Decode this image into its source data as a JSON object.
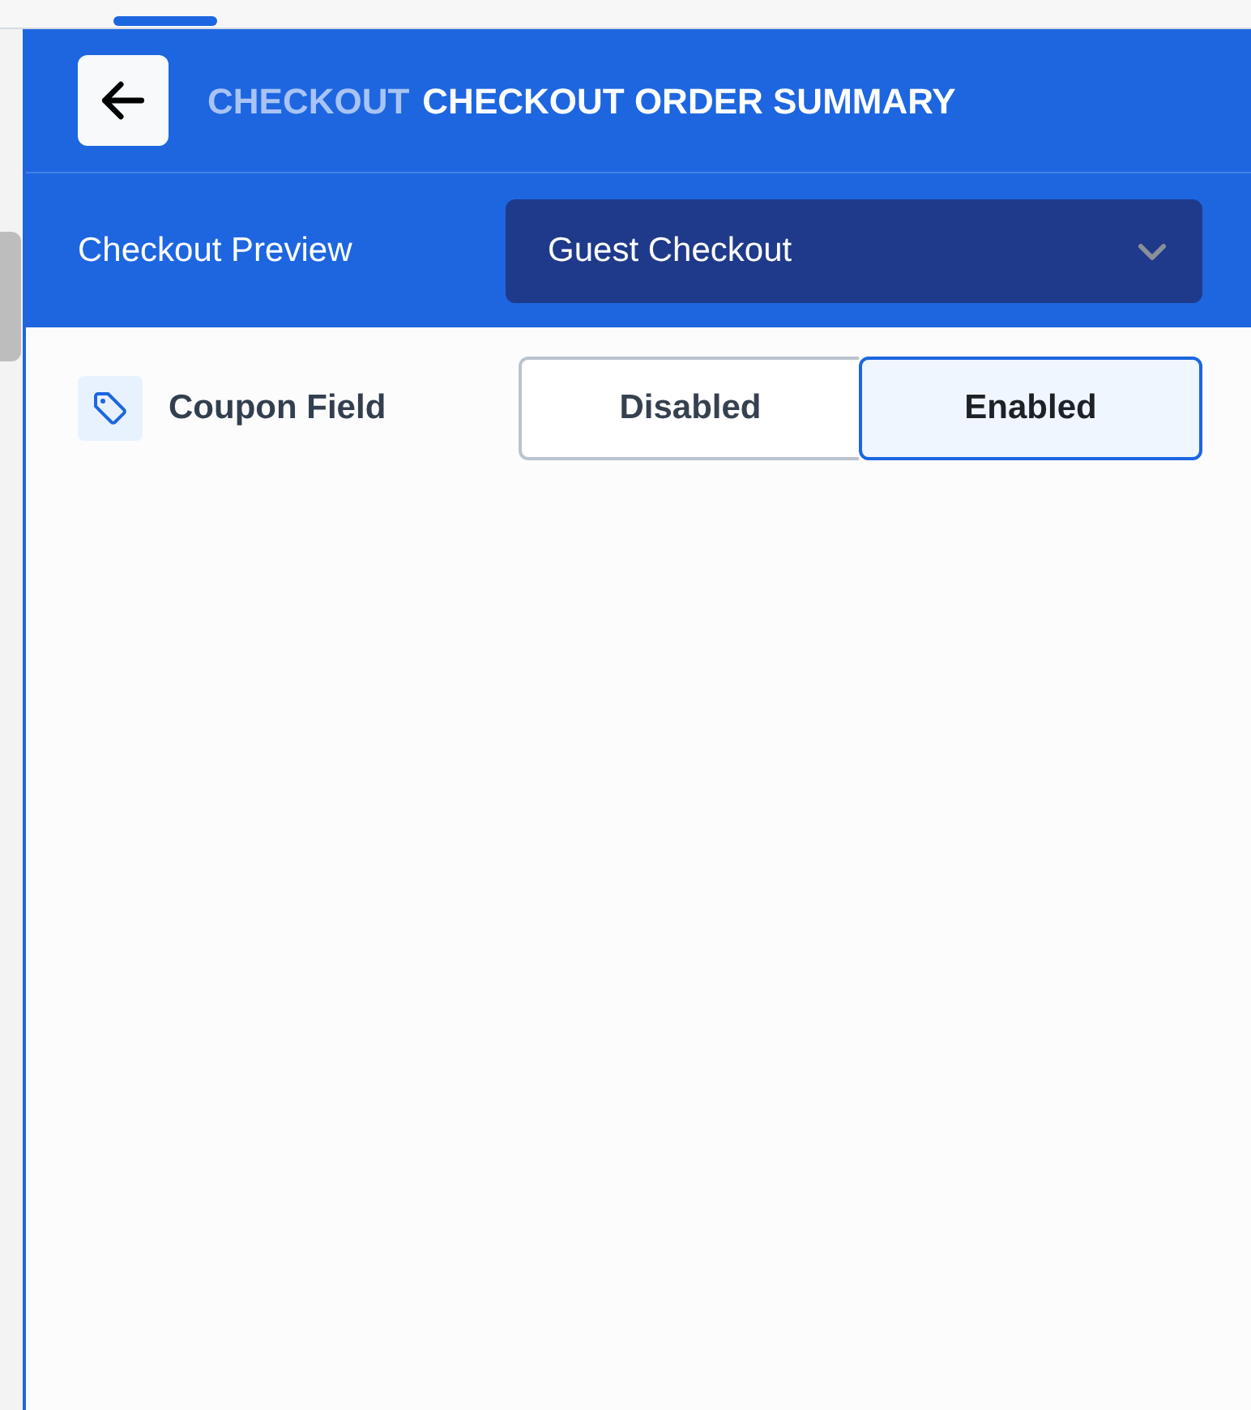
{
  "header": {
    "title_prefix": "CHECKOUT",
    "title": "CHECKOUT ORDER SUMMARY"
  },
  "preview": {
    "label": "Checkout Preview",
    "value": "Guest Checkout"
  },
  "settings": [
    {
      "label": "Coupon Field",
      "options": [
        {
          "label": "Disabled",
          "selected": false
        },
        {
          "label": "Enabled",
          "selected": true
        }
      ]
    }
  ]
}
